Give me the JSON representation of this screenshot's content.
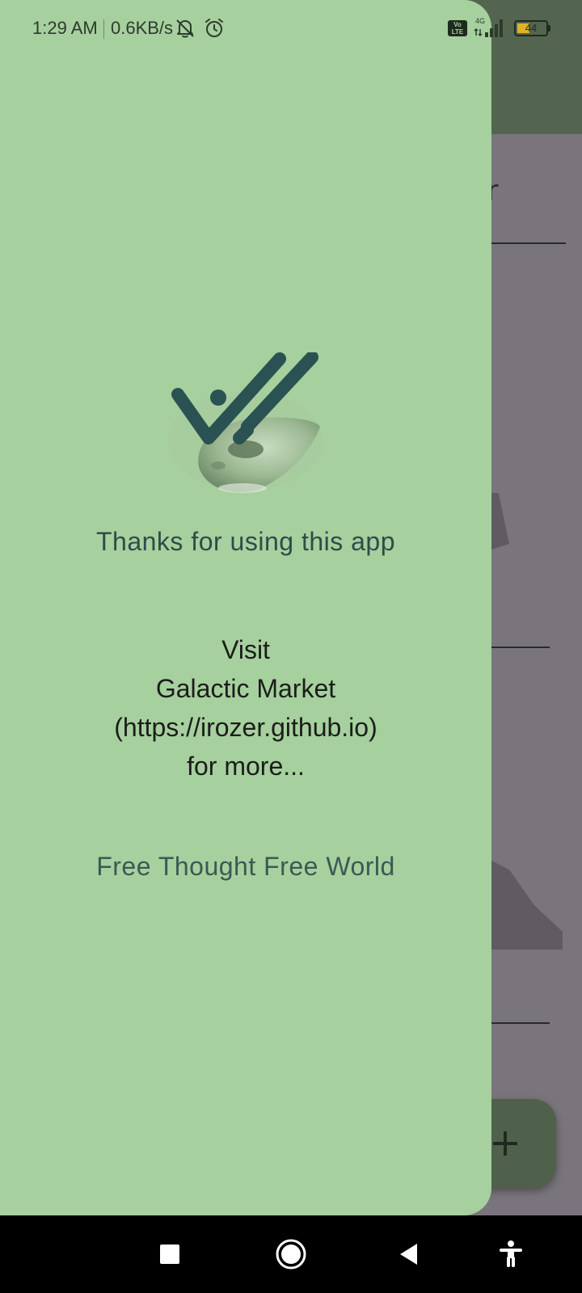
{
  "status_bar": {
    "time": "1:29 AM",
    "network_speed": "0.6KB/s",
    "icons": [
      "bell-off-icon",
      "alarm-icon",
      "volte-icon",
      "signal-4g-icon",
      "battery-icon"
    ],
    "volte_label": "Vo LTE",
    "network_type": "4G",
    "battery_level": "44",
    "battery_fraction": 0.44,
    "battery_color": "#e1b12a"
  },
  "background": {
    "field_text_partial": "ner",
    "fab_icon": "plus-icon"
  },
  "drawer": {
    "logo_icon": "double-check-alien-logo",
    "thanks": "Thanks for using this app",
    "visit_lines": [
      "Visit",
      "Galactic Market",
      "(https://irozer.github.io)",
      "for more..."
    ],
    "tagline": "Free Thought Free World"
  },
  "nav_bar": {
    "icons": [
      "recents-icon",
      "home-icon",
      "back-icon",
      "accessibility-icon"
    ]
  },
  "colors": {
    "drawer_bg": "#a6d09e",
    "appbar_bg": "#53654f",
    "scrim": "#7a757c",
    "accent_text": "#2d4d48"
  }
}
